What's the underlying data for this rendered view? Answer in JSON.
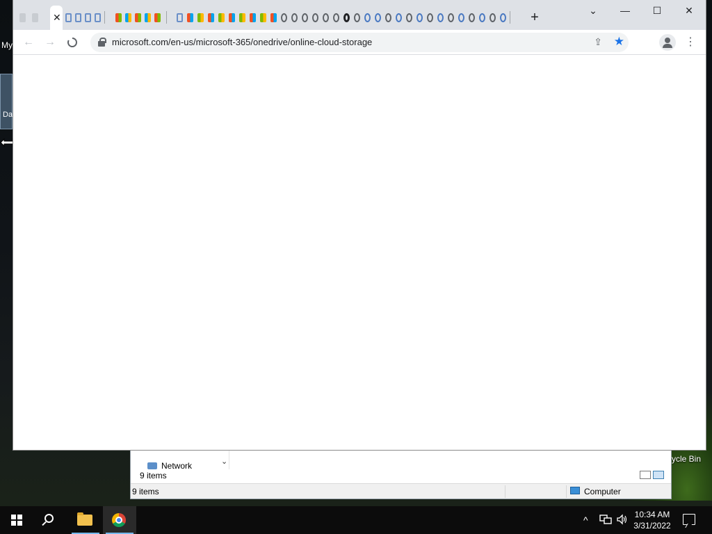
{
  "desktop": {
    "top_left_label": "My",
    "left_icon_label": "Da",
    "recycle_bin_label": "ycle Bin"
  },
  "explorer": {
    "nav_item": "Network",
    "items_count": "9 items",
    "status_items": "9 items",
    "status_location": "Computer"
  },
  "browser": {
    "active_tab_close": "✕",
    "new_tab_label": "+",
    "window_controls": {
      "tab_search": "⌄",
      "minimize": "—",
      "maximize": "☐",
      "close": "✕"
    },
    "toolbar": {
      "back": "←",
      "forward": "→",
      "stop": "✕",
      "share": "⇪",
      "bookmark": "★",
      "menu": "⋮"
    },
    "url": "microsoft.com/en-us/microsoft-365/onedrive/online-cloud-storage",
    "loading": true
  },
  "taskbar": {
    "tray_chevron": "^",
    "time": "10:34 AM",
    "date": "3/31/2022"
  },
  "colors": {
    "accent": "#1a73e8",
    "tabstrip": "#dee1e6",
    "taskbar": "#0c0c0c"
  }
}
